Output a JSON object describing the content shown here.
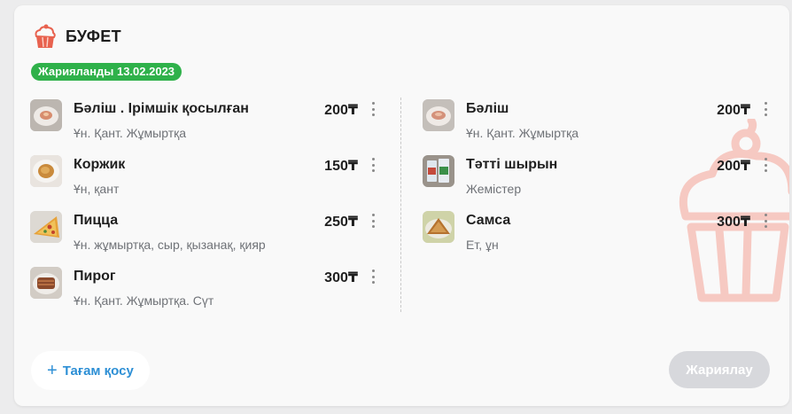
{
  "header": {
    "icon": "cupcake-icon",
    "title": "БУФЕТ"
  },
  "badge": {
    "text": "Жарияланды 13.02.2023",
    "color": "#2fb14a"
  },
  "menu": {
    "left": [
      {
        "name": "Бәліш . Ірімшік қосылған",
        "desc": "Ұн. Қант. Жұмыртқа",
        "price": "200₸",
        "thumb": "pie-with-cheese"
      },
      {
        "name": "Коржик",
        "desc": "Ұн, қант",
        "price": "150₸",
        "thumb": "korzhik"
      },
      {
        "name": "Пицца",
        "desc": "Ұн. жұмыртқа, сыр, қызанақ, қияр",
        "price": "250₸",
        "thumb": "pizza"
      },
      {
        "name": "Пирог",
        "desc": "Ұн. Қант. Жұмыртқа. Сүт",
        "price": "300₸",
        "thumb": "pirog"
      }
    ],
    "right": [
      {
        "name": "Бәліш",
        "desc": "Ұн. Қант. Жұмыртқа",
        "price": "200₸",
        "thumb": "balish"
      },
      {
        "name": "Тәтті шырын",
        "desc": "Жемістер",
        "price": "200₸",
        "thumb": "juice"
      },
      {
        "name": "Самса",
        "desc": "Ет, ұн",
        "price": "300₸",
        "thumb": "samsa"
      }
    ]
  },
  "actions": {
    "add_icon": "+",
    "add_label": "Тағам қосу",
    "publish_label": "Жариялау"
  },
  "colors": {
    "accent": "#2d8fd5",
    "badge": "#2fb14a",
    "publish_disabled": "#d7d8dc"
  }
}
